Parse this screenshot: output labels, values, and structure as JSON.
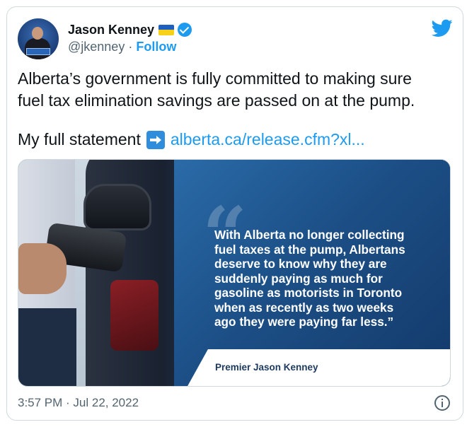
{
  "author": {
    "name": "Jason Kenney",
    "handle": "@jkenney",
    "separator": "·",
    "follow_label": "Follow",
    "flag_icon": "ukraine-flag-icon",
    "verified_icon": "verified-badge-icon",
    "verified_color": "#1d9bf0"
  },
  "tweet": {
    "text_line1": "Alberta’s government is fully committed to making sure",
    "text_line2": "fuel tax elimination savings are passed on at the pump.",
    "statement_label": "My full statement",
    "statement_icon": "right-arrow-icon",
    "link_text": "alberta.ca/release.cfm?xl...",
    "link_color": "#1d9bf0"
  },
  "media": {
    "quote_mark": "“",
    "quote_lines": [
      "With Alberta no longer collecting",
      "fuel taxes at the pump, Albertans",
      "deserve to know why they are",
      "suddenly paying as much for",
      "gasoline as motorists in Toronto",
      "when as recently as two weeks",
      "ago they were paying far less.”"
    ],
    "attribution": "Premier Jason Kenney"
  },
  "footer": {
    "timestamp": "3:57 PM · Jul 22, 2022",
    "info_icon": "info-icon"
  },
  "brand": {
    "icon": "twitter-bird-icon",
    "color": "#1d9bf0"
  }
}
